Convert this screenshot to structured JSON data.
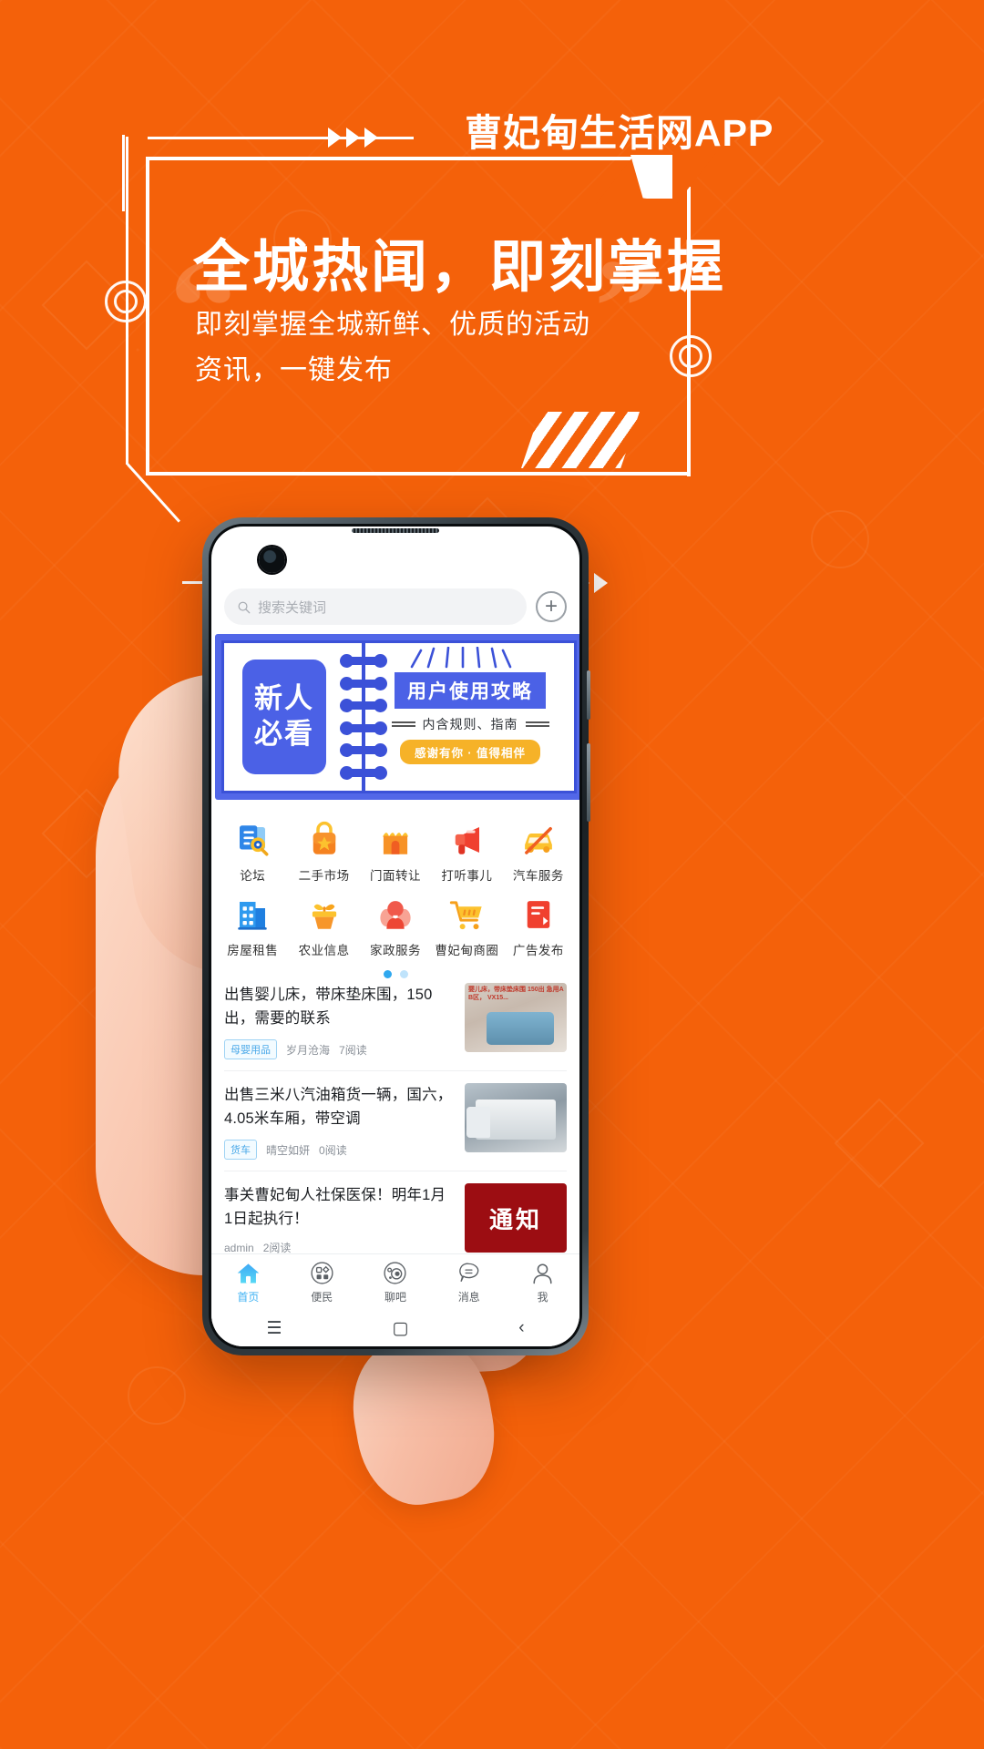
{
  "theme": {
    "brand_orange": "#F4610A",
    "banner_blue": "#4B61E6",
    "accent_blue": "#3FB2F3",
    "pill_yellow": "#F6B228",
    "notice_red": "#9C0D12"
  },
  "hero": {
    "app_title": "曹妃甸生活网APP",
    "headline": "全城热闻，即刻掌握",
    "subline_line1": "即刻掌握全城新鲜、优质的活动",
    "subline_line2": "资讯，一键发布",
    "quote_open": "“",
    "quote_close": "”"
  },
  "phone": {
    "search": {
      "placeholder": "搜索关键词",
      "icon": "search-icon",
      "add_icon": "plus-icon"
    },
    "banner": {
      "badge_line1": "新人",
      "badge_line2": "必看",
      "title": "用户使用攻略",
      "subtitle": "内含规则、指南",
      "pill": "感谢有你 · 值得相伴"
    },
    "grid": {
      "rows": [
        [
          {
            "label": "论坛",
            "icon": "document-search-icon"
          },
          {
            "label": "二手市场",
            "icon": "shopping-bag-star-icon"
          },
          {
            "label": "门面转让",
            "icon": "storefront-icon"
          },
          {
            "label": "打听事儿",
            "icon": "megaphone-icon"
          },
          {
            "label": "汽车服务",
            "icon": "car-icon"
          }
        ],
        [
          {
            "label": "房屋租售",
            "icon": "building-icon"
          },
          {
            "label": "农业信息",
            "icon": "sprout-pot-icon"
          },
          {
            "label": "家政服务",
            "icon": "housekeeper-icon"
          },
          {
            "label": "曹妃甸商圈",
            "icon": "shopping-cart-icon"
          },
          {
            "label": "广告发布",
            "icon": "ad-board-icon"
          }
        ]
      ],
      "page_dots": {
        "count": 2,
        "active_index": 0
      }
    },
    "articles": [
      {
        "title": "出售婴儿床，带床垫床围，150出，需要的联系",
        "tag": "母婴用品",
        "author": "岁月沧海",
        "reads": "7阅读",
        "thumb_kind": "photo-crib",
        "thumb_overlay": "婴儿床，带床垫床围\n150出\n急用A B区，\nVX15..."
      },
      {
        "title": "出售三米八汽油箱货一辆，国六，4.05米车厢，带空调",
        "tag": "货车",
        "author": "晴空如妍",
        "reads": "0阅读",
        "thumb_kind": "photo-truck",
        "thumb_overlay": ""
      },
      {
        "title": "事关曹妃甸人社保医保！明年1月1日起执行！",
        "tag": "",
        "author": "admin",
        "reads": "2阅读",
        "thumb_kind": "notice",
        "thumb_overlay": "通知"
      }
    ],
    "tabbar": [
      {
        "label": "首页",
        "icon": "home-icon",
        "active": true
      },
      {
        "label": "便民",
        "icon": "grid-circle-icon",
        "active": false
      },
      {
        "label": "聊吧",
        "icon": "orbit-circle-icon",
        "active": false
      },
      {
        "label": "消息",
        "icon": "chat-bubble-icon",
        "active": false
      },
      {
        "label": "我",
        "icon": "person-icon",
        "active": false
      }
    ],
    "android_nav": {
      "recent": "☰",
      "home": "▢",
      "back": "‹"
    }
  }
}
